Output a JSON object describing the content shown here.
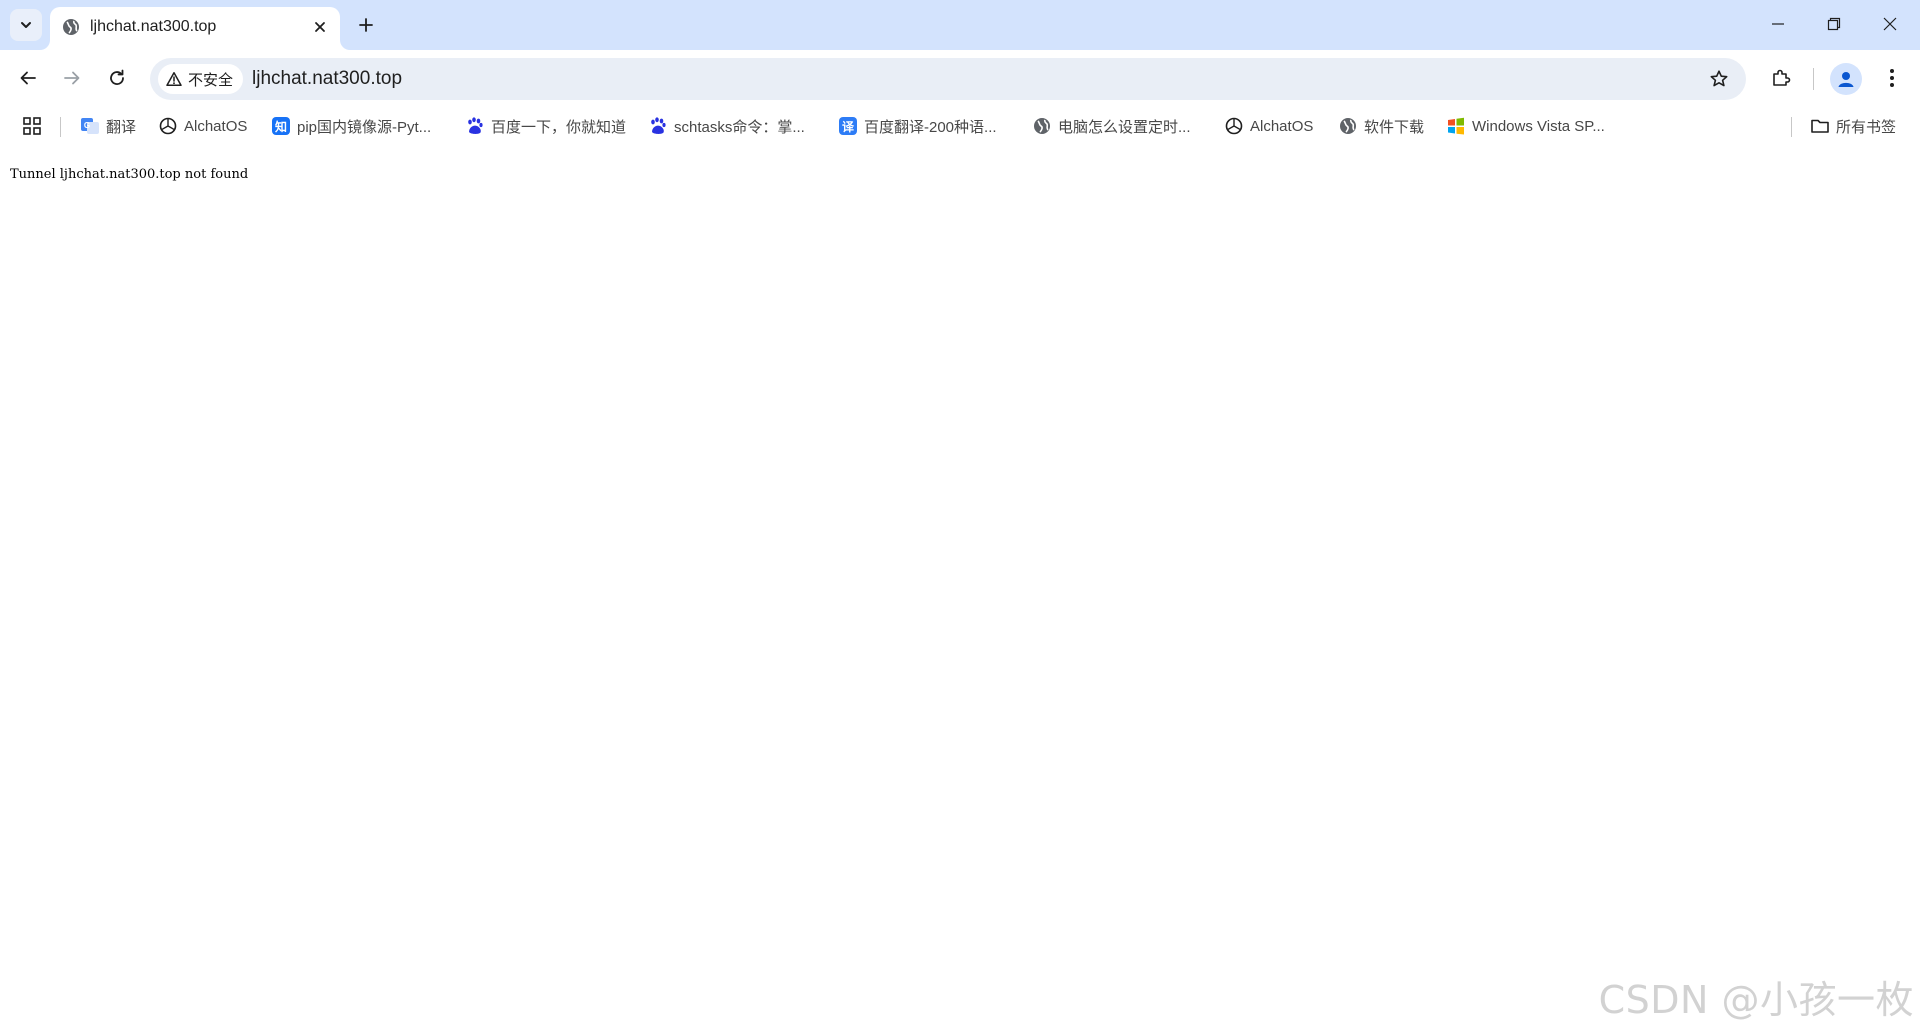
{
  "tab": {
    "title": "ljhchat.nat300.top"
  },
  "omnibox": {
    "security_label": "不安全",
    "url": "ljhchat.nat300.top"
  },
  "bookmarks": {
    "items": [
      {
        "label": "翻译",
        "icon": "google-translate-icon"
      },
      {
        "label": "AlchatOS",
        "icon": "openai-icon"
      },
      {
        "label": "pip国内镜像源-Pyt...",
        "icon": "zhihu-icon"
      },
      {
        "label": "百度一下，你就知道",
        "icon": "baidu-icon"
      },
      {
        "label": "schtasks命令：掌...",
        "icon": "baidu-icon"
      },
      {
        "label": "百度翻译-200种语...",
        "icon": "baidu-translate-icon"
      },
      {
        "label": "电脑怎么设置定时...",
        "icon": "globe-icon"
      },
      {
        "label": "AlchatOS",
        "icon": "openai-icon"
      },
      {
        "label": "软件下载",
        "icon": "globe-icon"
      },
      {
        "label": "Windows Vista SP...",
        "icon": "windows-icon"
      }
    ],
    "all_bookmarks_label": "所有书签"
  },
  "page": {
    "message": "Tunnel ljhchat.nat300.top not found"
  },
  "watermark": {
    "text": "CSDN @小孩一枚"
  },
  "colors": {
    "tabstrip": "#d3e3fd",
    "omnibox": "#e9eef6",
    "baidu_blue": "#2932e1",
    "zhihu_blue": "#1772f6"
  }
}
